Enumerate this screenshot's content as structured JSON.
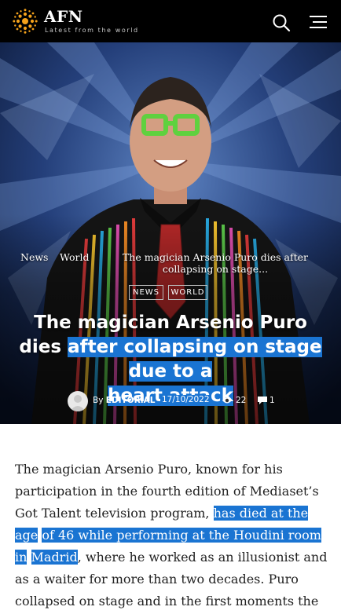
{
  "header": {
    "logo_text": "AFN",
    "tagline": "Latest from the world"
  },
  "breadcrumb": {
    "items": [
      "News",
      "World",
      "The magician Arsenio Puro dies after collapsing on stage..."
    ]
  },
  "categories": [
    "NEWS",
    "WORLD"
  ],
  "article": {
    "headline_part1": "The magician Arsenio Puro dies ",
    "headline_sel1": "after collapsing on stage due to a",
    "headline_sel2": "heart attack",
    "by_label": "By",
    "author": "EDITORIAL",
    "date": "17/10/2022",
    "views": "22",
    "comments": "1",
    "body_part1": "The magician Arsenio Puro, known for his participation in the fourth edition of Mediaset’s Got Talent television program, ",
    "body_sel1": "has died at the age",
    "body_sel2": "of 46 while performing at the Houdini room in",
    "body_sel3": "Madrid",
    "body_part2": ", where he worked as an illusionist and as a waiter for more than two decades. Puro collapsed on stage and in the first moments the attendees"
  },
  "icons": {
    "logo": "sun-logo-icon",
    "search": "search-icon",
    "menu": "hamburger-menu-icon",
    "views": "eye-icon",
    "comments": "comment-icon",
    "avatar": "user-avatar-icon"
  },
  "colors": {
    "header_bg": "#000000",
    "logo_accent": "#f4a21b",
    "selection": "#1a74d2",
    "body_text": "#222222"
  }
}
